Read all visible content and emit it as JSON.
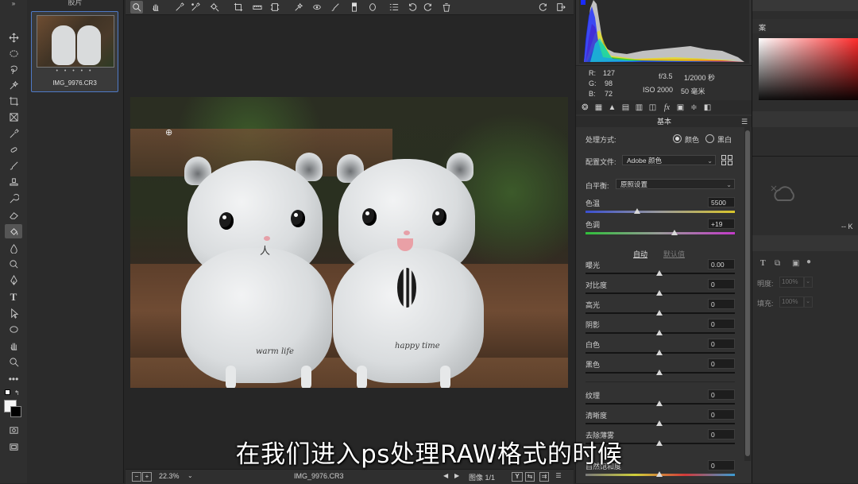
{
  "filmstrip": {
    "title": "胶片",
    "thumbnail_name": "IMG_9976.CR3",
    "dots": "• • • • •"
  },
  "status": {
    "zoom": "22.3%",
    "filename": "IMG_9976.CR3",
    "image_count": "图像 1/1",
    "y_label": "Y"
  },
  "readout": {
    "r_label": "R:",
    "r": "127",
    "g_label": "G:",
    "g": "98",
    "b_label": "B:",
    "b": "72",
    "aperture": "f/3.5",
    "shutter": "1/2000 秒",
    "iso": "ISO 2000",
    "focal": "50 毫米"
  },
  "basic": {
    "header": "基本",
    "treatment_label": "处理方式:",
    "treatment_color": "颜色",
    "treatment_bw": "黑白",
    "profile_label": "配置文件:",
    "profile_value": "Adobe 颜色",
    "wb_label": "白平衡:",
    "wb_value": "原照设置",
    "temp_label": "色温",
    "temp_value": "5500",
    "tint_label": "色调",
    "tint_value": "+19",
    "auto_label": "自动",
    "default_label": "默认值",
    "exposure_label": "曝光",
    "exposure_value": "0.00",
    "contrast_label": "对比度",
    "contrast_value": "0",
    "highlights_label": "高光",
    "highlights_value": "0",
    "shadows_label": "阴影",
    "shadows_value": "0",
    "whites_label": "白色",
    "whites_value": "0",
    "blacks_label": "黑色",
    "blacks_value": "0",
    "texture_label": "纹理",
    "texture_value": "0",
    "clarity_label": "清晰度",
    "clarity_value": "0",
    "dehaze_label": "去除薄雾",
    "dehaze_value": "0",
    "vibrance_label": "自然饱和度",
    "vibrance_value": "0"
  },
  "photo": {
    "text_left": "warm life",
    "text_right": "happy time"
  },
  "ps_right": {
    "tab_label": "案",
    "opacity_label": "明度:",
    "opacity_value": "100%",
    "fill_label": "填充:",
    "fill_value": "100%",
    "dash": "-- K"
  },
  "subtitle": "在我们进入ps处理RAW格式的时候",
  "colors": {
    "accent_blue": "#4f7ac7",
    "panel_bg": "#323232"
  }
}
